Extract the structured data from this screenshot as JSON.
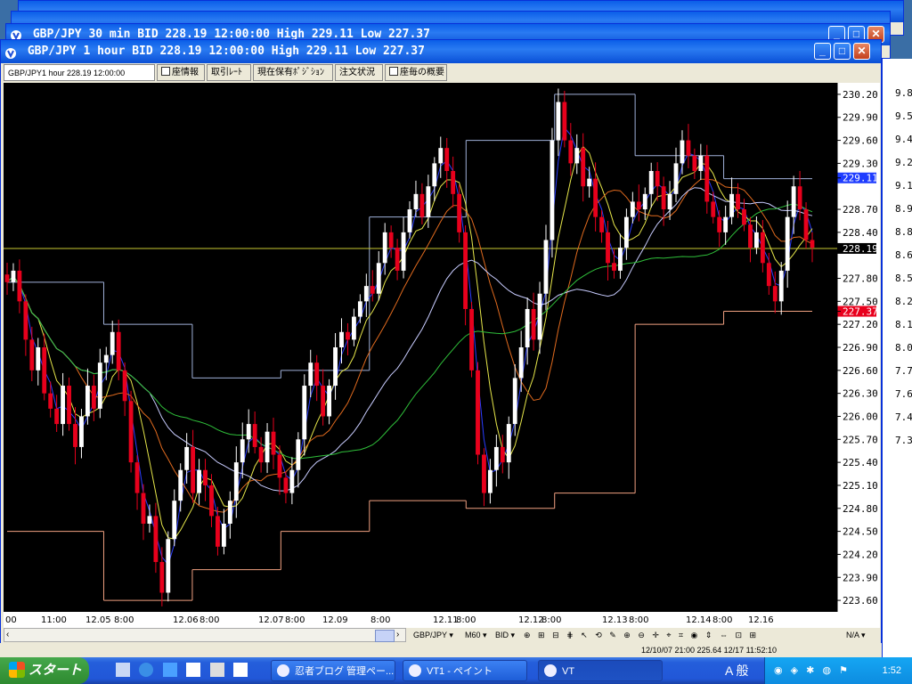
{
  "back_window": {
    "title": "GBP/JPY 30 min BID 228.19 12:00:00 High 229.11 Low 227.37"
  },
  "main_window": {
    "title": "GBP/JPY 1 hour BID 228.19 12:00:00 High 229.11 Low 227.37",
    "tabs": [
      {
        "label": "GBP/JPY1 hour 228.19 12:00:00",
        "active": true,
        "checkbox": false
      },
      {
        "label": "座情報",
        "active": false,
        "checkbox": true
      },
      {
        "label": "取引ﾚｰﾄ",
        "active": false,
        "checkbox": false
      },
      {
        "label": "現在保有ﾎﾟｼﾞｼｮﾝ",
        "active": false,
        "checkbox": false
      },
      {
        "label": "注文状況",
        "active": false,
        "checkbox": false
      },
      {
        "label": "座毎の概要",
        "active": false,
        "checkbox": true
      }
    ],
    "price_axis": [
      "230.20",
      "229.90",
      "229.60",
      "229.30",
      "229.11",
      "228.70",
      "228.40",
      "228.19",
      "227.80",
      "227.50",
      "227.37",
      "227.20",
      "226.90",
      "226.60",
      "226.30",
      "226.00",
      "225.70",
      "225.40",
      "225.10",
      "224.80",
      "224.50",
      "224.20",
      "223.90",
      "223.60"
    ],
    "price_axis_marked": {
      "high": "229.11",
      "bid": "228.19",
      "low": "227.37"
    },
    "time_axis": [
      "00",
      "11:00",
      "12.05",
      "8:00",
      "12.06",
      "8:00",
      "12.07",
      "8:00",
      "12.09",
      "8:00",
      "12.11",
      "8:00",
      "12.12",
      "8:00",
      "12.13",
      "8:00",
      "12.14",
      "8:00",
      "12.16"
    ],
    "toolbar": {
      "symbol": "GBP/JPY",
      "timeframe": "M60",
      "side": "BID",
      "na": "N/A"
    },
    "status": "12/10/07 21:00 225.64 12/17 11:52:10"
  },
  "right_panel_values": [
    "9.8",
    "9.5",
    "9.4",
    "9.2",
    "9.1",
    "8.9",
    "8.8",
    "8.6",
    "8.5",
    "8.2",
    "8.1",
    "8.0",
    "7.7",
    "7.6",
    "7.4",
    "7.3"
  ],
  "taskbar": {
    "start": "スタート",
    "items": [
      {
        "label": "忍者ブログ 管理ペー...",
        "active": false
      },
      {
        "label": "VT1 - ペイント",
        "active": false
      },
      {
        "label": "VT",
        "active": true
      }
    ],
    "ime": "A 般",
    "clock": "1:52"
  },
  "colors": {
    "chart_bg": "#000000",
    "up_candle": "#ffffff",
    "down_candle": "#e8001c",
    "ma_blue": "#2a3cff",
    "ma_yellow": "#e6e64a",
    "ma_orange": "#e06a1e",
    "ma_white": "#c8ccff",
    "ma_green": "#2fbf3a",
    "box_high": "#9fb0d8",
    "box_low": "#f0a080",
    "bid_line": "#c8c832"
  }
}
